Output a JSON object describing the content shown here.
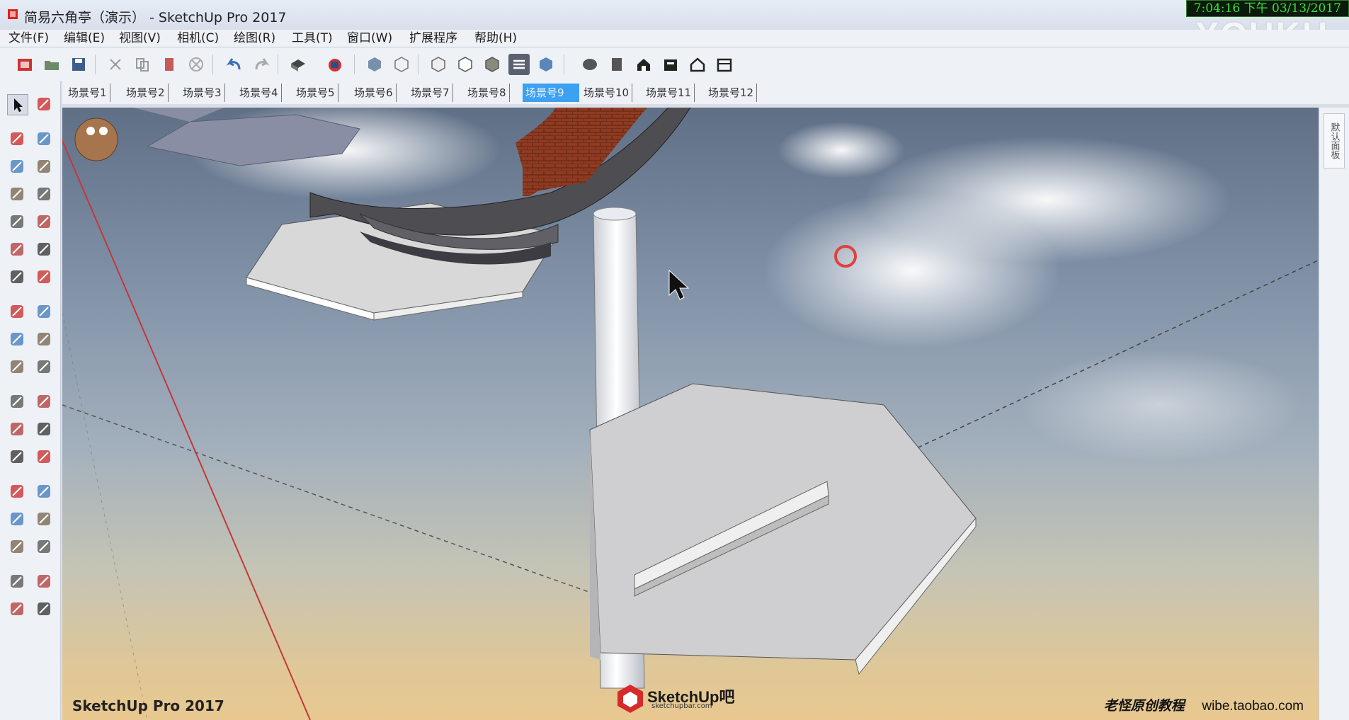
{
  "window": {
    "title": "简易六角亭（演示） - SketchUp Pro 2017",
    "clock": "7:04:16 下午 03/13/2017",
    "watermark": "YOUKU"
  },
  "menu": [
    "文件(F)",
    "编辑(E)",
    "视图(V)",
    "相机(C)",
    "绘图(R)",
    "工具(T)",
    "窗口(W)",
    "扩展程序",
    "帮助(H)"
  ],
  "toolbar_icons": [
    "new-model-icon",
    "open-folder-icon",
    "save-icon",
    "cut-icon",
    "copy-icon",
    "paste-icon",
    "erase-icon",
    "undo-icon",
    "redo-icon",
    "print-icon",
    "model-info-icon",
    "xray-icon",
    "wireframe-icon",
    "hidden-line-icon",
    "shaded-icon",
    "shaded-texture-icon",
    "monochrome-icon",
    "iso-view-icon",
    "top-view-icon",
    "front-view-icon",
    "right-view-icon",
    "back-view-icon",
    "left-view-icon",
    "bottom-view-icon"
  ],
  "scene_tabs": [
    "场景号1",
    "场景号2",
    "场景号3",
    "场景号4",
    "场景号5",
    "场景号6",
    "场景号7",
    "场景号8",
    "场景号9",
    "场景号10",
    "场景号11",
    "场景号12"
  ],
  "active_scene": "场景号9",
  "left_tools": [
    [
      "select-arrow-icon",
      "component-icon"
    ],
    [
      "paint-bucket-icon",
      "eraser-icon"
    ],
    [
      "line-pencil-icon",
      "freehand-icon"
    ],
    [
      "rectangle-icon",
      "rotated-rectangle-icon"
    ],
    [
      "circle-icon",
      "polygon-icon"
    ],
    [
      "arc-icon",
      "pie-icon"
    ],
    [
      "two-point-arc-icon",
      "three-point-arc-icon"
    ],
    [
      "move-icon",
      "push-pull-icon"
    ],
    [
      "rotate-icon",
      "follow-me-icon"
    ],
    [
      "scale-icon",
      "offset-icon"
    ],
    [
      "tape-measure-icon",
      "dimension-icon"
    ],
    [
      "protractor-icon",
      "text-icon"
    ],
    [
      "axes-icon",
      "3d-text-icon"
    ],
    [
      "orbit-icon",
      "pan-icon"
    ],
    [
      "zoom-icon",
      "zoom-window-icon"
    ],
    [
      "zoom-extents-icon",
      "previous-view-icon"
    ],
    [
      "position-camera-icon",
      "look-around-icon"
    ],
    [
      "walk-icon",
      "section-plane-icon"
    ]
  ],
  "viewport": {
    "label": "SketchUp Pro 2017",
    "logo_text": "SketchUp吧",
    "logo_url": "sketchupbar.com",
    "credit_cn": "老怪原创教程",
    "credit_url": "wibe.taobao.com"
  },
  "right_panel": {
    "tab": "默认面板"
  }
}
